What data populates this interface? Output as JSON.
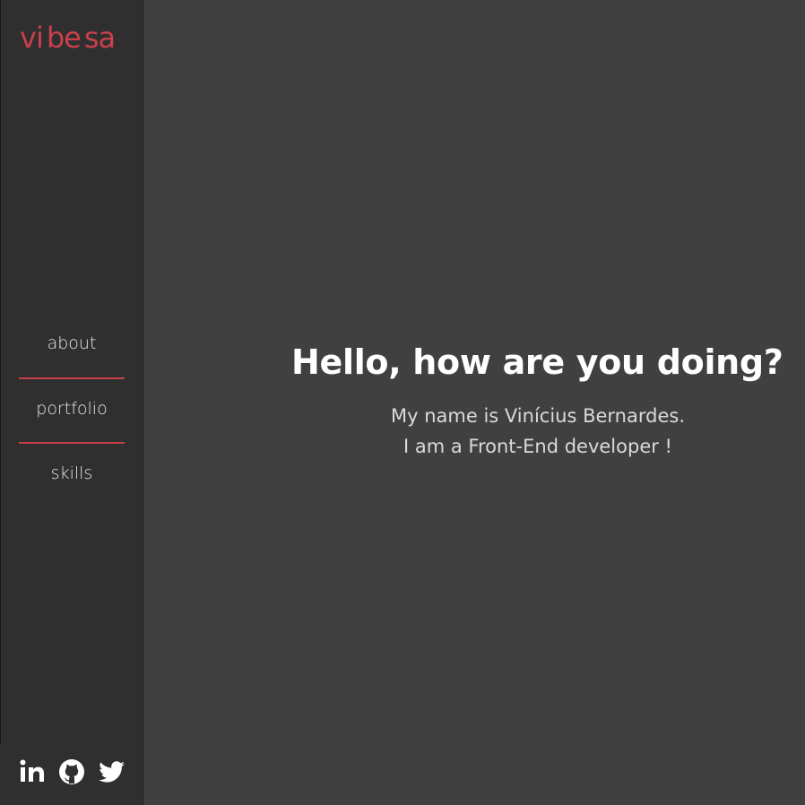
{
  "brand": {
    "logo_text_a": "vi",
    "logo_text_b": "be",
    "logo_text_c": "sa",
    "logo_color": "#c9404c"
  },
  "sidebar": {
    "nav": [
      {
        "label": "about"
      },
      {
        "label": "portfolio"
      },
      {
        "label": "skills"
      }
    ],
    "divider_color": "#c9404c",
    "social": [
      {
        "icon": "linkedin-icon"
      },
      {
        "icon": "github-icon"
      },
      {
        "icon": "twitter-icon"
      }
    ]
  },
  "hero": {
    "title": "Hello, how are you doing?",
    "line1": "My name is Vinícius Bernardes.",
    "line2": "I am a Front-End developer !"
  },
  "colors": {
    "background": "#404040",
    "sidebar": "#2f2f2f",
    "accent": "#c9404c"
  }
}
